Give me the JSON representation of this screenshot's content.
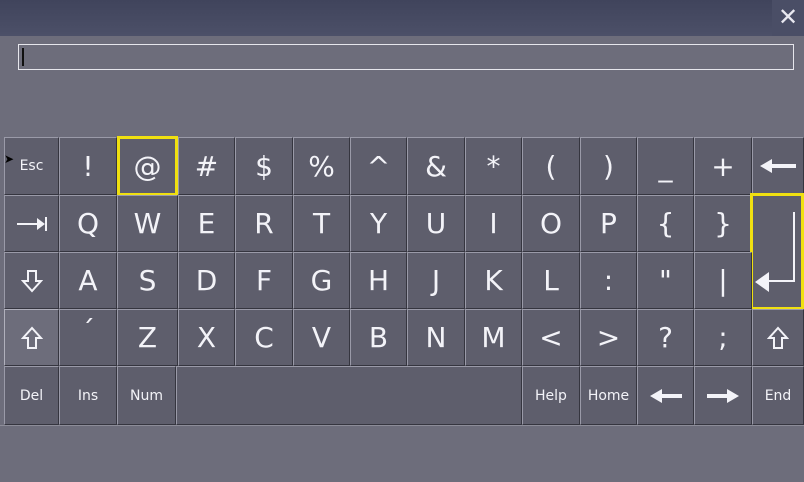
{
  "window": {
    "close_icon": "close-icon"
  },
  "input": {
    "value": ""
  },
  "keys": {
    "esc": "Esc",
    "exclam": "!",
    "at": "@",
    "hash": "#",
    "dollar": "$",
    "percent": "%",
    "caret": "^",
    "amp": "&",
    "star": "*",
    "lparen": "(",
    "rparen": ")",
    "underscore": "_",
    "plus": "+",
    "q": "Q",
    "w": "W",
    "e": "E",
    "r": "R",
    "t": "T",
    "y": "Y",
    "u": "U",
    "i": "I",
    "o": "O",
    "p": "P",
    "lbrace": "{",
    "rbrace": "}",
    "a": "A",
    "s": "S",
    "d": "D",
    "f": "F",
    "g": "G",
    "h": "H",
    "j": "J",
    "k": "K",
    "l": "L",
    "colon": ":",
    "quote": "\"",
    "pipe": "|",
    "acute": "´",
    "z": "Z",
    "x": "X",
    "c": "C",
    "v": "V",
    "b": "B",
    "n": "N",
    "m": "M",
    "lt": "<",
    "gt": ">",
    "question": "?",
    "semicolon": ";",
    "del": "Del",
    "ins": "Ins",
    "num": "Num",
    "help": "Help",
    "home": "Home",
    "end": "End"
  },
  "highlight_color": "#f0e010"
}
